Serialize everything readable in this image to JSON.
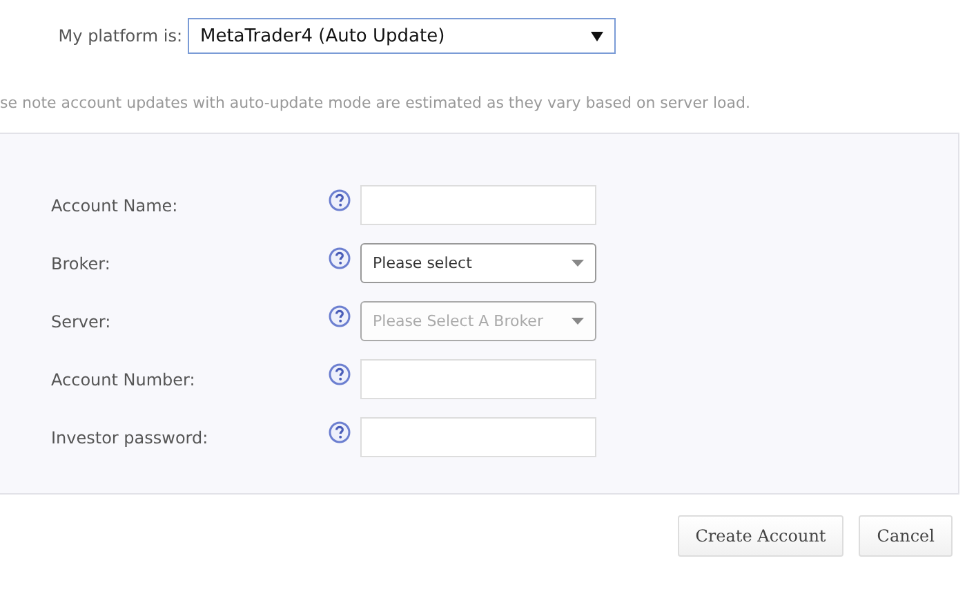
{
  "platform": {
    "label": "My platform is:",
    "value": "MetaTrader4 (Auto Update)"
  },
  "note": "se note account updates with auto-update mode are estimated as they vary based on server load.",
  "fields": [
    {
      "label": "Account Name:",
      "kind": "text"
    },
    {
      "label": "Broker:",
      "kind": "select",
      "value": "Please select",
      "disabled": false
    },
    {
      "label": "Server:",
      "kind": "select",
      "placeholder": "Please Select A Broker",
      "disabled": true
    },
    {
      "label": "Account Number:",
      "kind": "text"
    },
    {
      "label": "Investor password:",
      "kind": "text"
    }
  ],
  "buttons": [
    "Create Account",
    "Cancel"
  ]
}
